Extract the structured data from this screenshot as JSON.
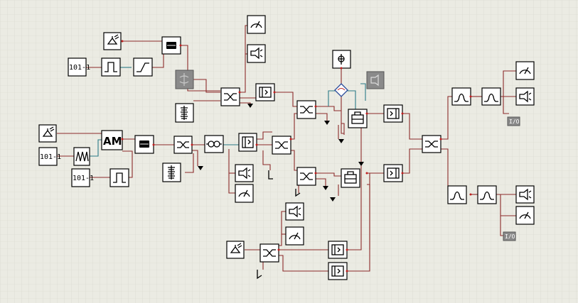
{
  "labels": {
    "bit_pattern": "101-1",
    "am": "AM",
    "io": "I/O"
  },
  "colors": {
    "background": "#ebebe3",
    "grid": "#d9d9d0",
    "wire_signal": "#8b2a2a",
    "wire_optical": "#2a7a86"
  }
}
